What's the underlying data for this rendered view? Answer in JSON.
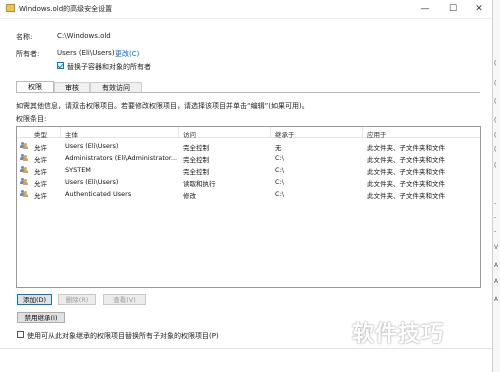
{
  "window": {
    "title": "Windows.old的高级安全设置",
    "minimize": "—",
    "maximize": "☐",
    "close": "✕"
  },
  "name_label": "名称:",
  "name_value": "C:\\Windows.old",
  "owner_label": "所有者:",
  "owner_value": "Users (Eli\\Users)",
  "owner_change": "更改(C)",
  "replace_owner_label": "替换子容器和对象的所有者",
  "replace_owner_checked": true,
  "tabs": [
    {
      "label": "权限",
      "active": true
    },
    {
      "label": "审核",
      "active": false
    },
    {
      "label": "有效访问",
      "active": false
    }
  ],
  "info_text": "如需其他信息，请双击权限项目。若要修改权限项目，请选择该项目并单击“编辑”(如果可用)。",
  "entries_label": "权限条目:",
  "columns": {
    "type": "类型",
    "principal": "主体",
    "access": "访问",
    "inherited": "继承于",
    "applies": "应用于"
  },
  "rows": [
    {
      "type": "允许",
      "principal": "Users (Eli\\Users)",
      "access": "完全控制",
      "inherited": "无",
      "applies": "此文件夹、子文件夹和文件"
    },
    {
      "type": "允许",
      "principal": "Administrators (Eli\\Administrator...",
      "access": "完全控制",
      "inherited": "C:\\",
      "applies": "此文件夹、子文件夹和文件"
    },
    {
      "type": "允许",
      "principal": "SYSTEM",
      "access": "完全控制",
      "inherited": "C:\\",
      "applies": "此文件夹、子文件夹和文件"
    },
    {
      "type": "允许",
      "principal": "Users (Eli\\Users)",
      "access": "读取和执行",
      "inherited": "C:\\",
      "applies": "此文件夹、子文件夹和文件"
    },
    {
      "type": "允许",
      "principal": "Authenticated Users",
      "access": "修改",
      "inherited": "C:\\",
      "applies": "此文件夹、子文件夹和文件"
    }
  ],
  "buttons": {
    "add": "添加(D)",
    "remove": "删除(R)",
    "view": "查看(V)",
    "disable_inherit": "禁用继承(I)"
  },
  "replace_child_label": "使用可从此对象继承的权限项目替换所有子对象的权限项目(P)",
  "replace_child_checked": false,
  "watermark": "软件技巧",
  "side_strip": [
    "(",
    "(",
    "(",
    "(",
    "(",
    "(",
    "(",
    "-",
    "-",
    "-",
    "V",
    "A",
    "A",
    "A"
  ]
}
